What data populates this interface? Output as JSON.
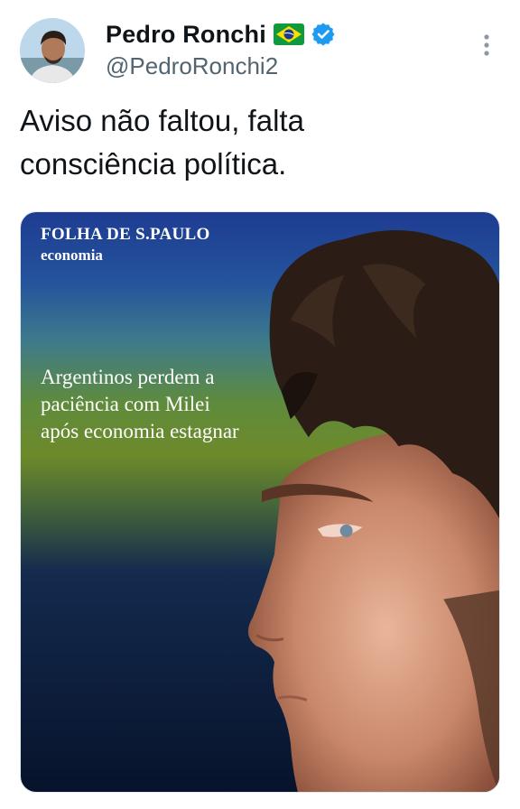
{
  "author": {
    "display_name": "Pedro Ronchi",
    "handle": "@PedroRonchi2",
    "flag_icon": "brazil-flag-icon",
    "verified_icon": "verified-badge-icon",
    "verified_color": "#1d9bf0"
  },
  "menu": {
    "icon": "more-vertical-icon"
  },
  "tweet": {
    "text": "Aviso não faltou, falta\nconsciência política."
  },
  "media": {
    "outlet_name": "FOLHA DE S.PAULO",
    "outlet_section": "economia",
    "headline": "Argentinos perdem a\npaciência com Milei\napós economia estagnar",
    "gradient_colors": [
      "#1f3f94",
      "#2e6f98",
      "#6f8d2b",
      "#0a1a3a"
    ]
  }
}
